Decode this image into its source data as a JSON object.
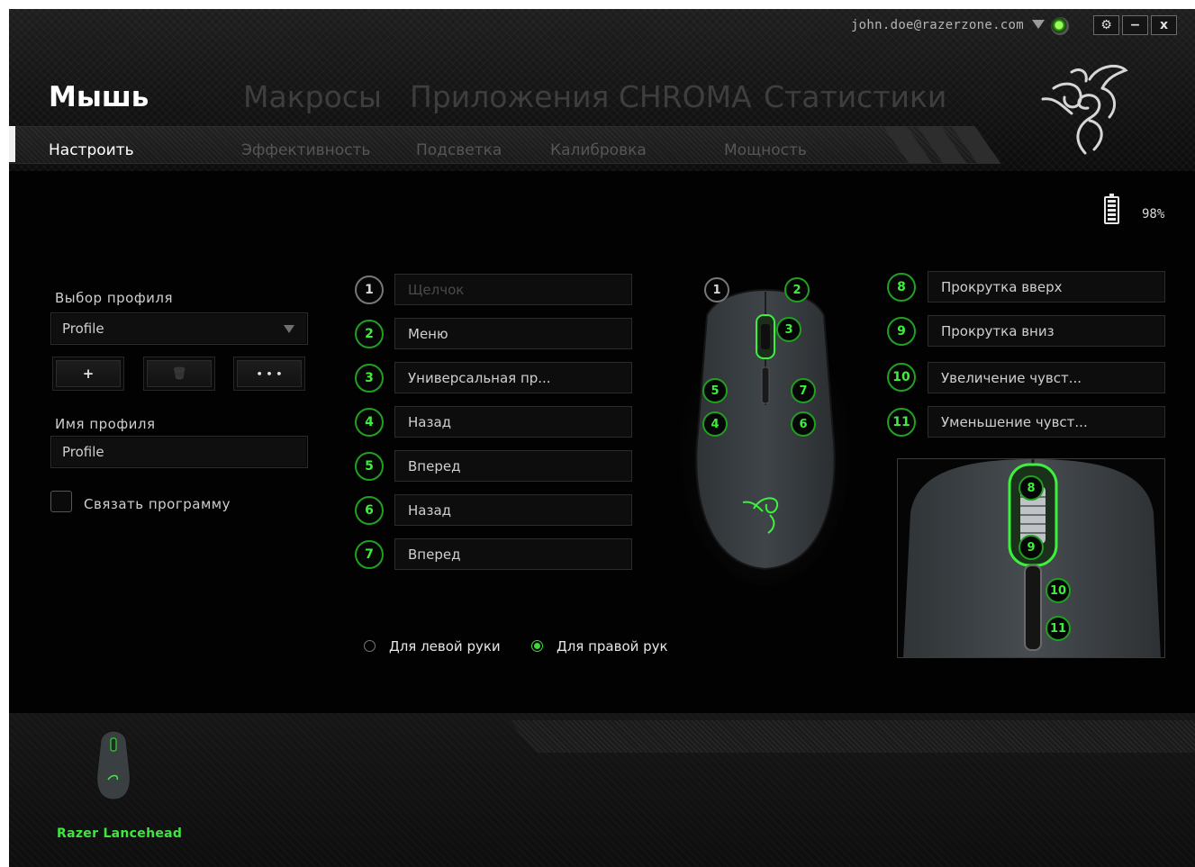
{
  "account": {
    "email": "john.doe@razerzone.com"
  },
  "window_controls": {
    "settings": "⚙",
    "minimize": "−",
    "close": "x"
  },
  "main_tabs": [
    {
      "label": "Мышь",
      "active": true
    },
    {
      "label": "Макросы",
      "active": false
    },
    {
      "label": "Приложения CHROMA",
      "active": false
    },
    {
      "label": "Статистики",
      "active": false
    }
  ],
  "sub_tabs": [
    {
      "label": "Настроить",
      "active": true
    },
    {
      "label": "Эффективность",
      "active": false
    },
    {
      "label": "Подсветка",
      "active": false
    },
    {
      "label": "Калибровка",
      "active": false
    },
    {
      "label": "Мощность",
      "active": false
    }
  ],
  "battery": {
    "percent": "98%"
  },
  "profile": {
    "select_label": "Выбор профиля",
    "selected": "Profile",
    "add_label": "+",
    "delete_label": "🗑",
    "more_label": "• • •",
    "name_label": "Имя профиля",
    "name_value": "Profile",
    "link_program_label": "Связать программу"
  },
  "buttons_left": [
    {
      "num": "1",
      "label": "Щелчок"
    },
    {
      "num": "2",
      "label": "Меню"
    },
    {
      "num": "3",
      "label": "Универсальная пр..."
    },
    {
      "num": "4",
      "label": "Назад"
    },
    {
      "num": "5",
      "label": "Вперед"
    },
    {
      "num": "6",
      "label": "Назад"
    },
    {
      "num": "7",
      "label": "Вперед"
    }
  ],
  "buttons_right": [
    {
      "num": "8",
      "label": "Прокрутка вверх"
    },
    {
      "num": "9",
      "label": "Прокрутка вниз"
    },
    {
      "num": "10",
      "label": "Увеличение чувст..."
    },
    {
      "num": "11",
      "label": "Уменьшение чувст..."
    }
  ],
  "mouse_diagram": {
    "markers": [
      "1",
      "2",
      "3",
      "5",
      "7",
      "4",
      "6"
    ]
  },
  "zoom_diagram": {
    "markers": [
      "8",
      "9",
      "10",
      "11"
    ]
  },
  "handedness": {
    "left_label": "Для левой руки",
    "right_label": "Для правой рук",
    "selected": "right"
  },
  "device": {
    "name": "Razer Lancehead"
  },
  "colors": {
    "accent": "#3cf03c",
    "background": "#020202"
  }
}
